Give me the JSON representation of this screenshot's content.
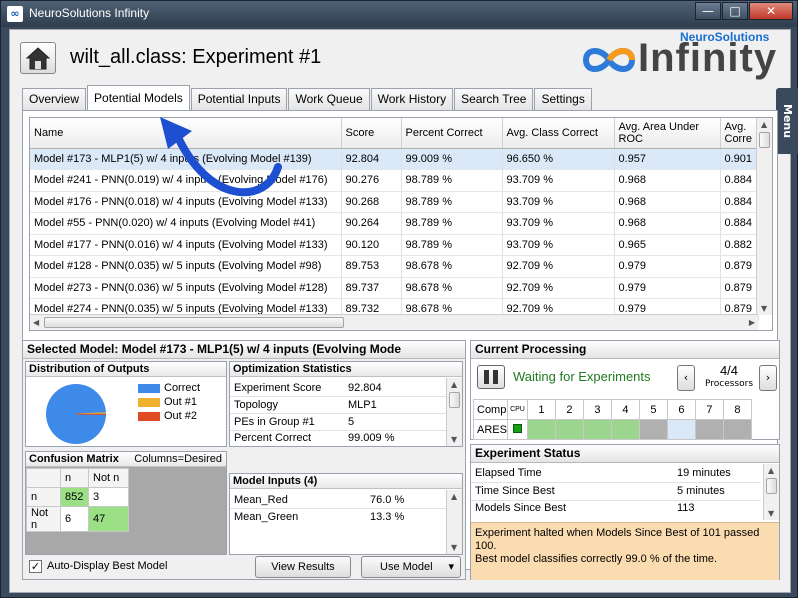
{
  "window": {
    "title": "NeuroSolutions Infinity",
    "min": "—",
    "max": "□",
    "close": "✕"
  },
  "header": {
    "title": "wilt_all.class:  Experiment #1",
    "logo_small": "NeuroSolutions",
    "logo_big": "Infinity",
    "menu": "Menu"
  },
  "tabs": [
    "Overview",
    "Potential Models",
    "Potential Inputs",
    "Work Queue",
    "Work History",
    "Search Tree",
    "Settings"
  ],
  "models": {
    "columns": [
      "Name",
      "Score",
      "Percent Correct",
      "Avg. Class Correct",
      "Avg. Area Under ROC",
      "Avg. Corre"
    ],
    "rows": [
      [
        "Model #173 - MLP1(5) w/ 4 inputs (Evolving Model #139)",
        "92.804",
        "99.009 %",
        "96.650 %",
        "0.957",
        "0.901"
      ],
      [
        "Model #241 - PNN(0.019) w/ 4 inputs (Evolving Model #176)",
        "90.276",
        "98.789 %",
        "93.709 %",
        "0.968",
        "0.884"
      ],
      [
        "Model #176 - PNN(0.018) w/ 4 inputs (Evolving Model #133)",
        "90.268",
        "98.789 %",
        "93.709 %",
        "0.968",
        "0.884"
      ],
      [
        "Model #55 - PNN(0.020) w/ 4 inputs (Evolving Model #41)",
        "90.264",
        "98.789 %",
        "93.709 %",
        "0.968",
        "0.884"
      ],
      [
        "Model #177 - PNN(0.016) w/ 4 inputs (Evolving Model #133)",
        "90.120",
        "98.789 %",
        "93.709 %",
        "0.965",
        "0.882"
      ],
      [
        "Model #128 - PNN(0.035) w/ 5 inputs (Evolving Model #98)",
        "89.753",
        "98.678 %",
        "92.709 %",
        "0.979",
        "0.879"
      ],
      [
        "Model #273 - PNN(0.036) w/ 5 inputs (Evolving Model #128)",
        "89.737",
        "98.678 %",
        "92.709 %",
        "0.979",
        "0.879"
      ],
      [
        "Model #274 - PNN(0.035) w/ 5 inputs (Evolving Model #133)",
        "89.732",
        "98.678 %",
        "92.709 %",
        "0.979",
        "0.879"
      ]
    ]
  },
  "selected": {
    "title": "Selected Model:  Model #173  - MLP1(5) w/ 4 inputs (Evolving Mode",
    "dist_title": "Distribution of Outputs",
    "legend": [
      {
        "label": "Correct",
        "color": "#3d8ae8",
        "share": 0.99
      },
      {
        "label": "Out #1",
        "color": "#f0b030",
        "share": 0.005
      },
      {
        "label": "Out #2",
        "color": "#e04a22",
        "share": 0.005
      }
    ],
    "cm_title": "Confusion Matrix",
    "cm_note": "Columns=Desired",
    "cm": {
      "col_headers": [
        "n",
        "Not n"
      ],
      "rows": [
        [
          "n",
          "852",
          "3"
        ],
        [
          "Not n",
          "6",
          "47"
        ]
      ]
    },
    "opt_title": "Optimization Statistics",
    "opt": [
      [
        "Experiment Score",
        "92.804"
      ],
      [
        "Topology",
        "MLP1"
      ],
      [
        "PEs in Group #1",
        "5"
      ],
      [
        "Percent Correct",
        "99.009 %"
      ]
    ],
    "inputs_title": "Model Inputs (4)",
    "inputs": [
      [
        "Mean_Red",
        "76.0 %"
      ],
      [
        "Mean_Green",
        "13.3 %"
      ]
    ],
    "auto_display": "Auto-Display Best Model",
    "view_results": "View Results",
    "use_model": "Use Model",
    "dropdown": "▾"
  },
  "processing": {
    "title": "Current Processing",
    "status": "Waiting for Experiments",
    "count": "4/4",
    "count_label": "Processors",
    "headers": [
      "Comp",
      "CPU",
      "1",
      "2",
      "3",
      "4",
      "5",
      "6",
      "7",
      "8"
    ],
    "row_name": "ARES"
  },
  "status": {
    "title": "Experiment Status",
    "rows": [
      [
        "Elapsed Time",
        "19 minutes"
      ],
      [
        "Time Since Best",
        "5 minutes"
      ],
      [
        "Models Since Best",
        "113"
      ]
    ],
    "message": "Experiment halted when Models Since Best of 101 passed 100.\nBest model classifies correctly 99.0 % of the time."
  }
}
